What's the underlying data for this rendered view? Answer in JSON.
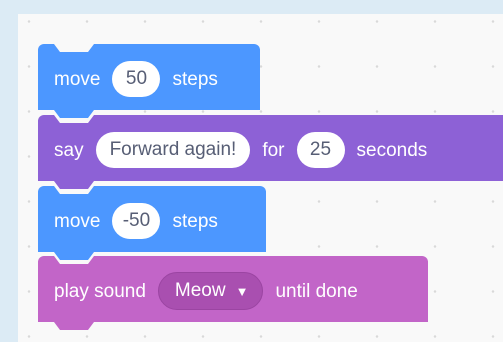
{
  "blocks": {
    "move1": {
      "label": "move",
      "value": "50",
      "suffix": "steps"
    },
    "say": {
      "label": "say",
      "message": "Forward again!",
      "mid": "for",
      "value": "25",
      "suffix": "seconds"
    },
    "move2": {
      "label": "move",
      "value": "-50",
      "suffix": "steps"
    },
    "play_sound": {
      "label": "play sound",
      "sound": "Meow",
      "suffix": "until done"
    }
  },
  "colors": {
    "motion": "#4c97ff",
    "looks": "#8d61d6",
    "sound": "#c265c8",
    "canvas": "#f9f9f9"
  },
  "icons": {
    "dropdown_caret": "caret-down-icon"
  }
}
